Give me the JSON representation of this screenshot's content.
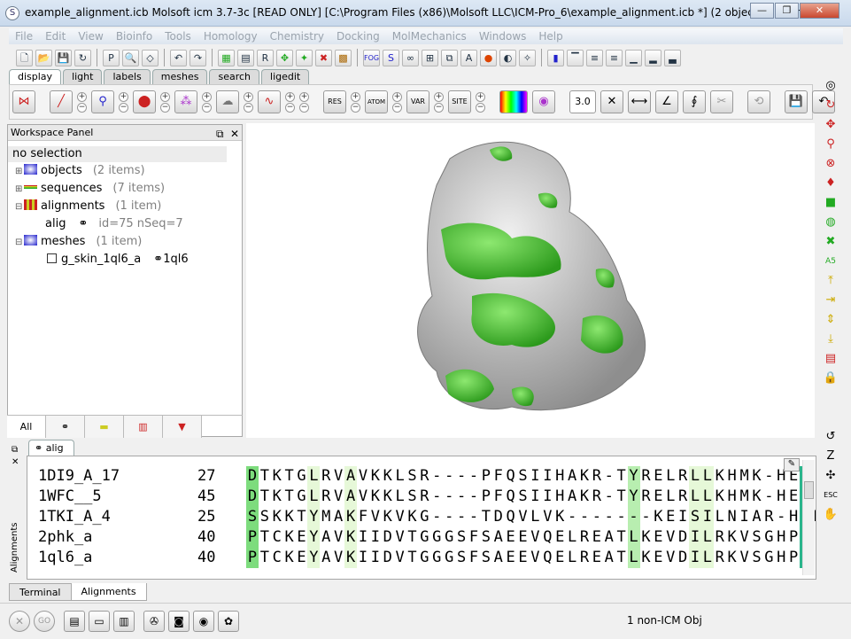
{
  "window": {
    "title": "example_alignment.icb Molsoft icm 3.7-3c [READ ONLY]  [C:\\Program Files (x86)\\Molsoft LLC\\ICM-Pro_6\\example_alignment.icb *] (2 objects 1 alignment)",
    "minimize": "—",
    "maximize": "❐",
    "close": "✕"
  },
  "menu": [
    "File",
    "Edit",
    "View",
    "Bioinfo",
    "Tools",
    "Homology",
    "Chemistry",
    "Docking",
    "MolMechanics",
    "Windows",
    "Help"
  ],
  "tabs": [
    "display",
    "light",
    "labels",
    "meshes",
    "search",
    "ligedit"
  ],
  "spin_value": "3.0",
  "workspace": {
    "title": "Workspace Panel",
    "selection": "no selection",
    "items": [
      {
        "label": "objects",
        "count": "(2 items)"
      },
      {
        "label": "sequences",
        "count": "(7 items)"
      },
      {
        "label": "alignments",
        "count": "(1 item)"
      },
      {
        "label": "alig",
        "count": "id=75 nSeq=7"
      },
      {
        "label": "meshes",
        "count": "(1 item)"
      },
      {
        "label": "g_skin_1ql6_a",
        "count": "1ql6"
      }
    ],
    "tabs": {
      "all": "All"
    }
  },
  "alignment": {
    "tab": "alig",
    "panel_label": "Alignments",
    "rows": [
      {
        "name": "1DI9_A_17",
        "num": "27",
        "seq": "DTKTGLRVAVKKLSR----PFQSIIHAKR-TYRELRLLKHMK-HEN"
      },
      {
        "name": "1WFC__5",
        "num": "45",
        "seq": "DTKTGLRVAVKKLSR----PFQSIIHAKR-TYRELRLLKHMK-HEN"
      },
      {
        "name": "1TKI_A_4",
        "num": "25",
        "seq": "SSKKTYMAKFVKVKG----TDQVLVK-------KEISILNIAR-HRN"
      },
      {
        "name": "2phk_a",
        "num": "40",
        "seq": "PTCKEYAVKIIDVTGGGSFSAEEVQELREATLKEVDILRKVSGHPN"
      },
      {
        "name": "1ql6_a",
        "num": "40",
        "seq": "PTCKEYAVKIIDVTGGGSFSAEEVQELREATLKEVDILRKVSGHPN"
      }
    ],
    "conservation": "1000030030000000000000000000000200003300000004000"
  },
  "bottom_tabs": [
    "Terminal",
    "Alignments"
  ],
  "status": "1 non-ICM Obj",
  "colors": {
    "surface_green": "#3fbf2a",
    "surface_gray": "#c8c8c8",
    "menu_disabled": "#9aa3ad"
  }
}
